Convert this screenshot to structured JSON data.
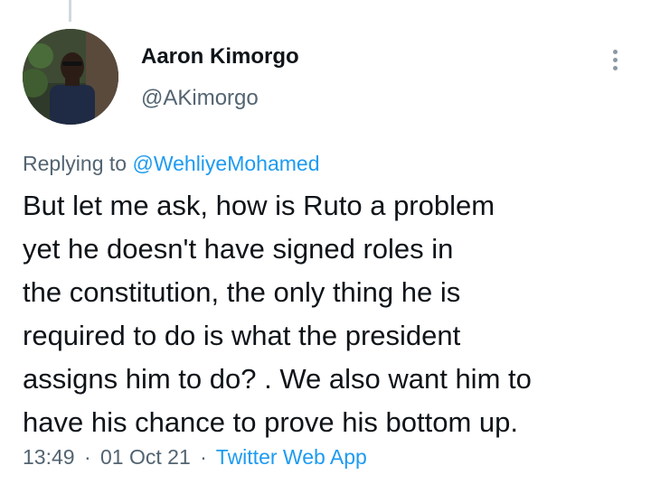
{
  "tweet": {
    "author": {
      "display_name": "Aaron Kimorgo",
      "handle": "@AKimorgo"
    },
    "replying_prefix": "Replying to",
    "replying_to": "@WehliyeMohamed",
    "text_lines": [
      "But let me ask, how is Ruto a problem",
      "yet he doesn't have signed roles in",
      "the constitution, the only thing he is",
      "required to do is what the president",
      "assigns him to do? . We also want him to",
      "have his chance to prove his bottom up."
    ],
    "time": "13:49",
    "separator": "·",
    "date": "01 Oct 21",
    "source": "Twitter Web App"
  },
  "icons": {
    "more": "more-vertical-icon"
  },
  "colors": {
    "text_primary": "#0f1419",
    "text_secondary": "#536471",
    "link": "#1d9bf0",
    "thread_line": "#cfd9de"
  }
}
